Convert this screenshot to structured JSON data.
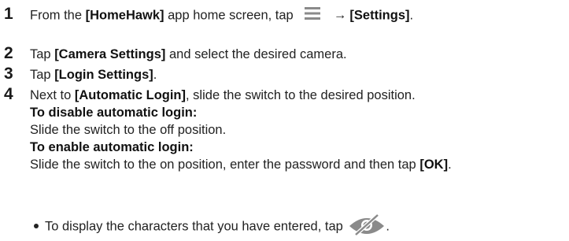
{
  "steps": [
    {
      "num": "1",
      "prefix": "From the ",
      "app": "[HomeHawk]",
      "middle": " app home screen, tap ",
      "menu_icon": "hamburger-menu-icon",
      "arrow": "→",
      "target": "[Settings]",
      "suffix": "."
    },
    {
      "num": "2",
      "prefix": "Tap ",
      "target": "[Camera Settings]",
      "suffix": " and select the desired camera."
    },
    {
      "num": "3",
      "prefix": "Tap ",
      "target": "[Login Settings]",
      "suffix": "."
    },
    {
      "num": "4",
      "prefix": "Next to ",
      "target": "[Automatic Login]",
      "suffix": ", slide the switch to the desired position.",
      "disable_heading": "To disable automatic login:",
      "disable_text": "Slide the switch to the off position.",
      "enable_heading": "To enable automatic login:",
      "enable_text_prefix": "Slide the switch to the on position, enter the password and then tap ",
      "enable_ok": "[OK]",
      "enable_text_suffix": "."
    }
  ],
  "note": {
    "text": "To display the characters that you have entered, tap ",
    "icon": "eye-hidden-icon",
    "suffix": "."
  },
  "colors": {
    "text": "#222222",
    "icon_gray": "#8a8a8a"
  }
}
